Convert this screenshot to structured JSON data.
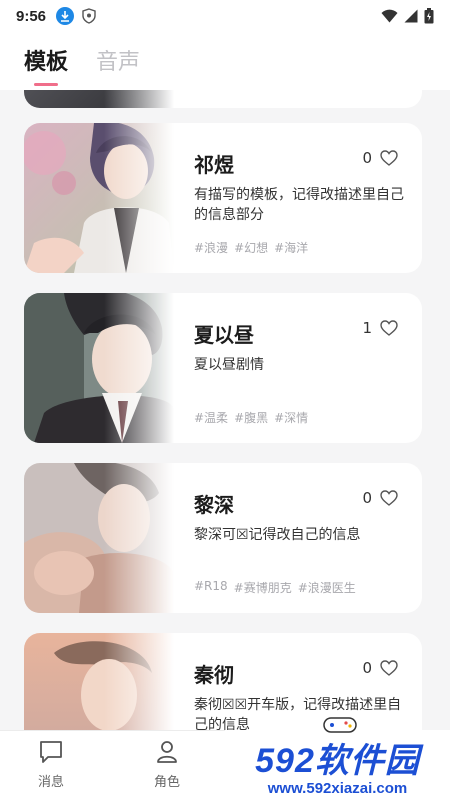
{
  "status_bar": {
    "time": "9:56"
  },
  "tabs": [
    {
      "label": "模板",
      "active": true
    },
    {
      "label": "音声",
      "active": false
    }
  ],
  "cards": [
    {
      "name": "祁煜",
      "likes": "0",
      "description": "有描写的模板，记得改描述里自己的信息部分",
      "tags": [
        "#浪漫",
        "#幻想",
        "#海洋"
      ]
    },
    {
      "name": "夏以昼",
      "likes": "1",
      "description": "夏以昼剧情",
      "tags": [
        "#温柔",
        "#腹黑",
        "#深情"
      ]
    },
    {
      "name": "黎深",
      "likes": "0",
      "description": "黎深可☒记得改自己的信息",
      "tags": [
        "#R18",
        "#赛博朋克",
        "#浪漫医生"
      ]
    },
    {
      "name": "秦彻",
      "likes": "0",
      "description": "秦彻☒☒开车版，记得改描述里自己的信息"
    }
  ],
  "bottom_nav": [
    {
      "label": "消息",
      "icon": "message-icon"
    },
    {
      "label": "角色",
      "icon": "person-icon"
    }
  ],
  "watermark": {
    "logo_num": "592",
    "logo_text": "软件园",
    "url": "www.592xiazai.com"
  },
  "colors": {
    "accent": "#f06e8a",
    "watermark_blue": "#1c4fd4"
  }
}
